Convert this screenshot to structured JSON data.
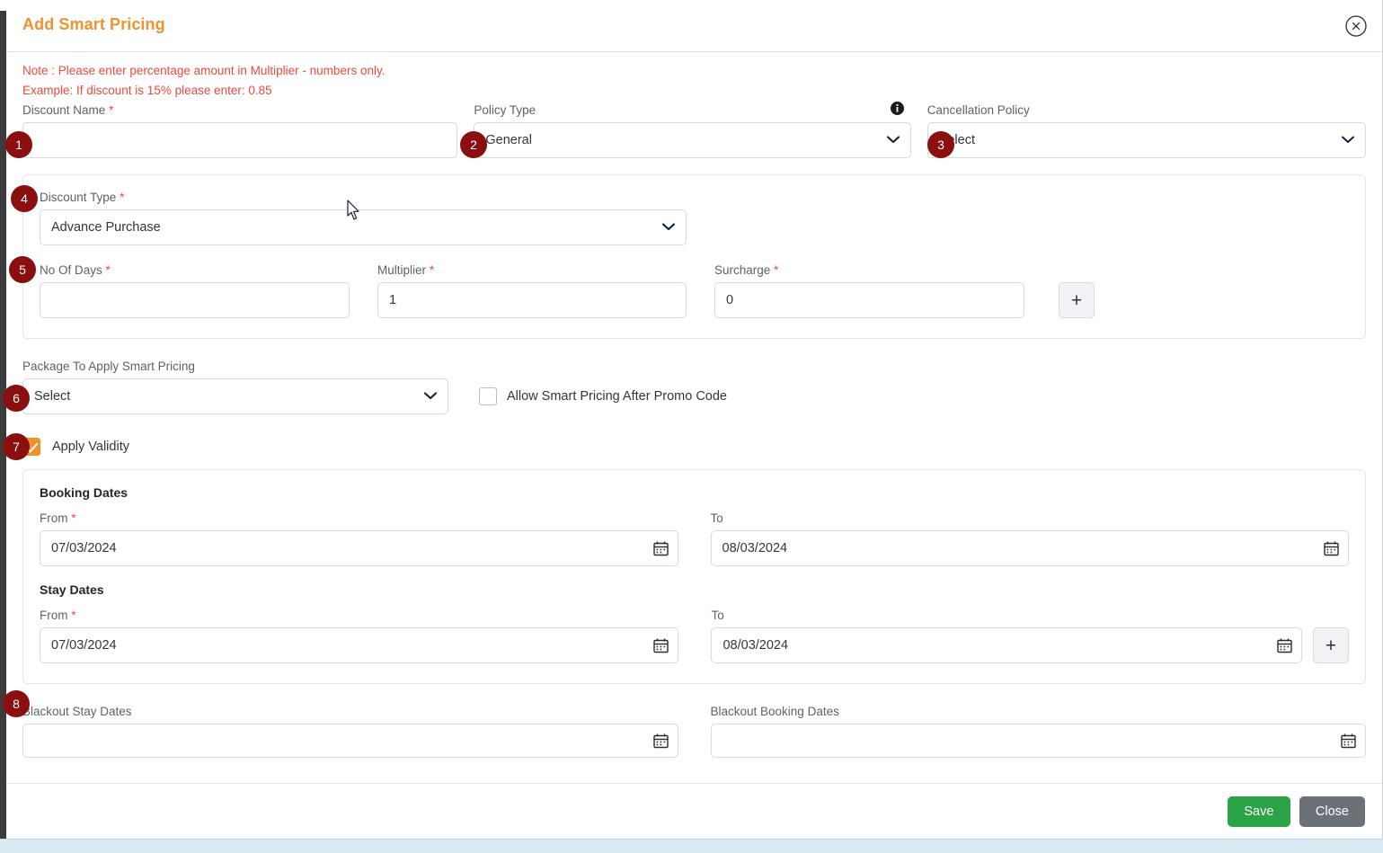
{
  "header": {
    "title": "Add Smart Pricing",
    "close_icon": "close-circle-icon"
  },
  "notes": {
    "line1": "Note : Please enter percentage amount in Multiplier - numbers only.",
    "line2": "Example: If discount is 15% please enter: 0.85",
    "color": "#f0483e"
  },
  "form": {
    "discount_name": {
      "label": "Discount Name",
      "required": "*",
      "value": "",
      "placeholder": ""
    },
    "policy_type": {
      "label": "Policy Type",
      "value": "General",
      "info_icon": "info-icon",
      "options": [
        "General"
      ]
    },
    "cancellation_policy": {
      "label": "Cancellation Policy",
      "value": "Select",
      "options": [
        "Select"
      ]
    },
    "discount_type": {
      "label": "Discount Type",
      "required": "*",
      "value": "Advance Purchase",
      "options": [
        "Advance Purchase"
      ]
    },
    "no_of_days": {
      "label": "No Of Days",
      "required": "*",
      "value": "",
      "placeholder": ""
    },
    "multiplier": {
      "label": "Multiplier",
      "required": "*",
      "value": "1"
    },
    "surcharge": {
      "label": "Surcharge",
      "required": "*",
      "value": "0"
    },
    "add_row_button": "+",
    "package": {
      "label": "Package To Apply Smart Pricing",
      "value": "Select",
      "options": [
        "Select"
      ]
    },
    "allow_promo": {
      "label": "Allow Smart Pricing After Promo Code",
      "checked": false
    },
    "apply_validity": {
      "label": "Apply Validity",
      "checked": true
    }
  },
  "validity": {
    "booking_dates": {
      "title": "Booking Dates",
      "from_label": "From",
      "from_required": "*",
      "from_value": "07/03/2024",
      "to_label": "To",
      "to_value": "08/03/2024"
    },
    "stay_dates": {
      "title": "Stay Dates",
      "from_label": "From",
      "from_required": "*",
      "from_value": "07/03/2024",
      "to_label": "To",
      "to_value": "08/03/2024",
      "add_button": "+"
    }
  },
  "blackout": {
    "stay": {
      "label": "Blackout Stay Dates",
      "value": ""
    },
    "booking": {
      "label": "Blackout Booking Dates",
      "value": ""
    }
  },
  "footer": {
    "save_label": "Save",
    "close_label": "Close",
    "save_color": "#2aa447",
    "close_color": "#6a7278"
  },
  "badges": [
    {
      "n": "1"
    },
    {
      "n": "2"
    },
    {
      "n": "3"
    },
    {
      "n": "4"
    },
    {
      "n": "5"
    },
    {
      "n": "6"
    },
    {
      "n": "7"
    },
    {
      "n": "8"
    }
  ]
}
